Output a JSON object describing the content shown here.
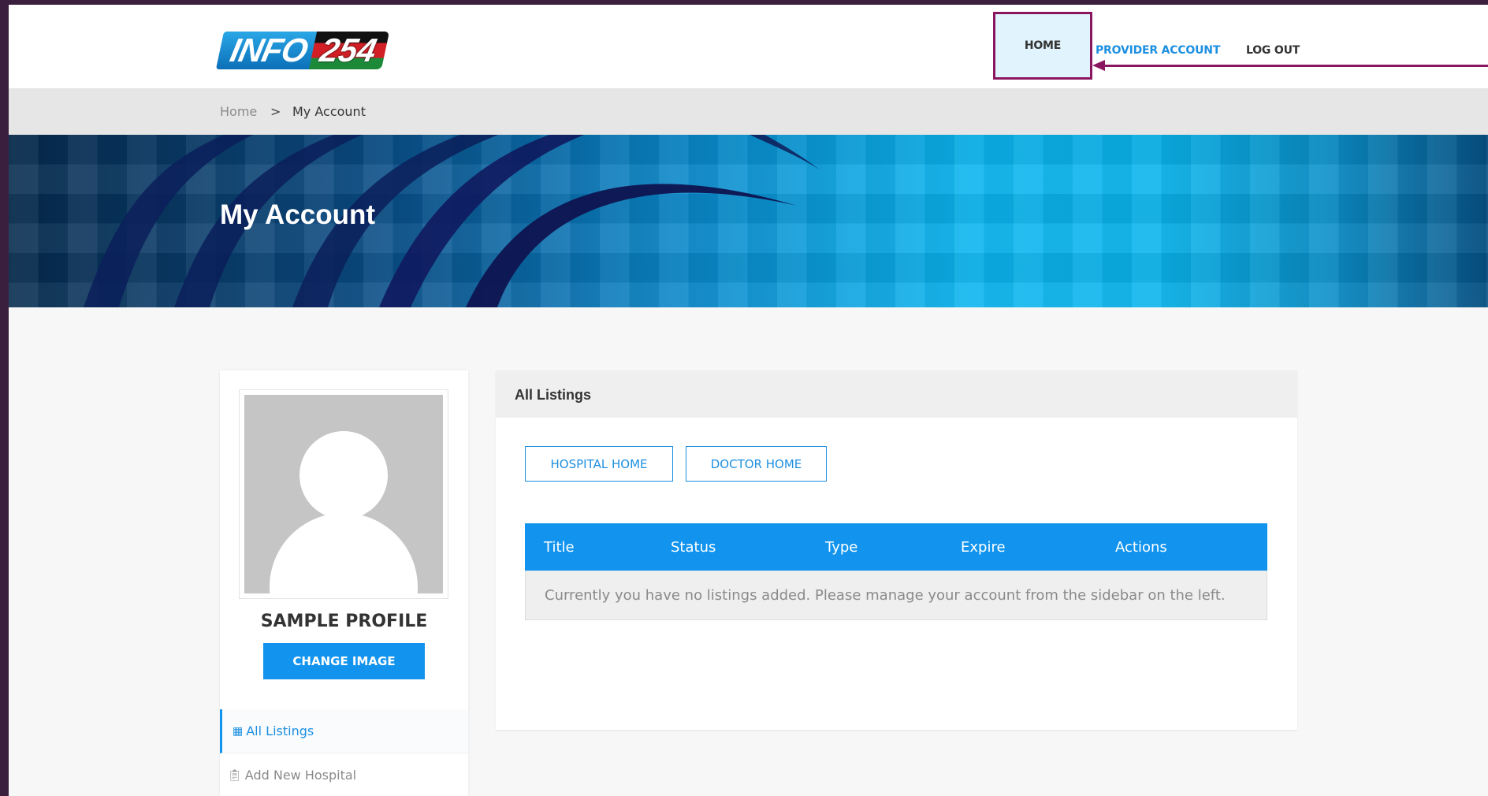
{
  "header": {
    "logo_text_part1": "INFO",
    "logo_text_part2": "254",
    "nav": {
      "home": "HOME",
      "provider_account": "PROVIDER ACCOUNT",
      "log_out": "LOG OUT"
    }
  },
  "breadcrumb": {
    "home": "Home",
    "separator": ">",
    "current": "My Account"
  },
  "hero": {
    "title": "My Account"
  },
  "sidebar": {
    "profile_name": "SAMPLE PROFILE",
    "change_image_label": "CHANGE IMAGE",
    "items": [
      {
        "label": "All Listings",
        "icon": "grid-icon",
        "active": true
      },
      {
        "label": "Add New Hospital",
        "icon": "clipboard-icon",
        "active": false
      }
    ]
  },
  "main": {
    "panel_title": "All Listings",
    "tabs": [
      {
        "label": "HOSPITAL HOME"
      },
      {
        "label": "DOCTOR HOME"
      }
    ],
    "table": {
      "columns": [
        "Title",
        "Status",
        "Type",
        "Expire",
        "Actions"
      ],
      "empty_message": "Currently you have no listings added. Please manage your account from the sidebar on the left."
    }
  },
  "colors": {
    "accent": "#1294ee",
    "annotation": "#8b1660",
    "link": "#1d8fe0"
  }
}
